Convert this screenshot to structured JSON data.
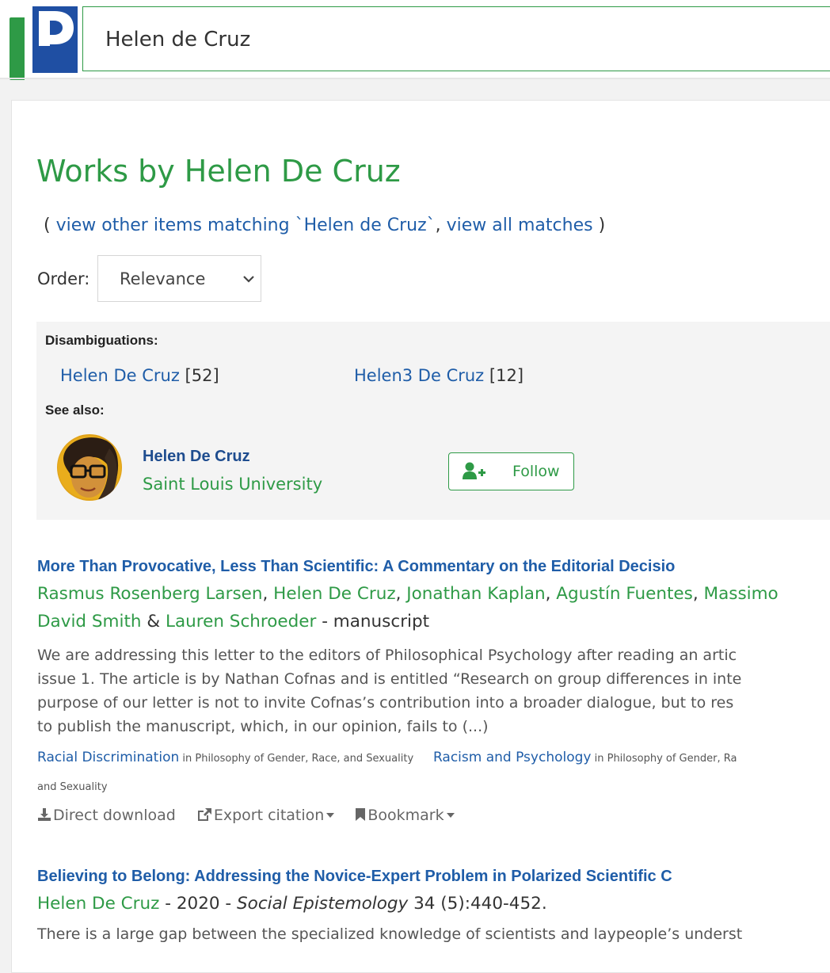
{
  "search": {
    "value": "Helen de Cruz"
  },
  "page": {
    "title": "Works by Helen De Cruz",
    "other_prefix": "( ",
    "other_link_1": "view other items matching `Helen de Cruz`",
    "other_sep": ", ",
    "other_link_2": "view all matches",
    "other_suffix": " )",
    "order_label": "Order:",
    "order_value": "Relevance"
  },
  "disambiguations": {
    "heading": "Disambiguations:",
    "items": [
      {
        "name": "Helen De Cruz",
        "count": "[52]"
      },
      {
        "name": "Helen3 De Cruz",
        "count": "[12]"
      }
    ],
    "see_also_heading": "See also:",
    "person": {
      "name": "Helen De Cruz",
      "affiliation": "Saint Louis University",
      "follow_label": "Follow"
    }
  },
  "entries": [
    {
      "title": "More Than Provocative, Less Than Scientific: A Commentary on the Editorial Decisio",
      "authors_line1": [
        {
          "name": "Rasmus Rosenberg Larsen",
          "sep": ", "
        },
        {
          "name": "Helen De Cruz",
          "sep": ", "
        },
        {
          "name": "Jonathan Kaplan",
          "sep": ", "
        },
        {
          "name": "Agustín Fuentes",
          "sep": ", "
        },
        {
          "name": "Massimo",
          "sep": ""
        }
      ],
      "authors_line2": [
        {
          "name": "David Smith",
          "sep": " & "
        },
        {
          "name": "Lauren Schroeder",
          "sep": ""
        }
      ],
      "pub_info": " - manuscript",
      "abstract": [
        "We are addressing this letter to the editors of Philosophical Psychology after reading an artic",
        "issue 1. The article is by Nathan Cofnas and is entitled “Research on group differences in inte",
        "purpose of our letter is not to invite Cofnas’s contribution into a broader dialogue, but to res",
        "to publish the manuscript, which, in our opinion, fails to (...)"
      ],
      "categories": [
        {
          "name": "Racial Discrimination",
          "in": " in Philosophy of Gender, Race, and Sexuality"
        },
        {
          "name": "Racism and Psychology",
          "in": " in Philosophy of Gender, Ra"
        }
      ],
      "categories_wrap": "and Sexuality",
      "actions": {
        "download": "Direct download",
        "export": "Export citation",
        "bookmark": "Bookmark"
      }
    },
    {
      "title": "Believing to Belong: Addressing the Novice-Expert Problem in Polarized Scientific C",
      "author": "Helen De Cruz",
      "year": " - 2020 - ",
      "journal": "Social Epistemology",
      "volume": " 34 (5):440-452.",
      "abstract_line1": "There is a large gap between the specialized knowledge of scientists and laypeople’s underst"
    }
  ],
  "colors": {
    "green": "#2e9a46",
    "blue_link": "#1f5da8",
    "logo_blue": "#1f4fa3"
  }
}
